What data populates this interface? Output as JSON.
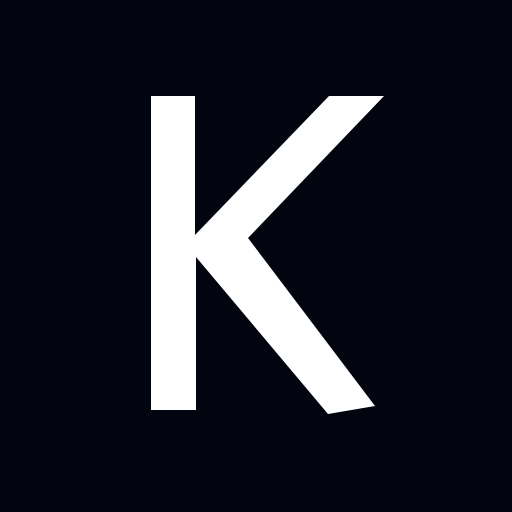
{
  "logo": {
    "letter": "K",
    "icon": "k-logo-icon",
    "foreground_color": "#ffffff",
    "background_color": "#020510"
  }
}
